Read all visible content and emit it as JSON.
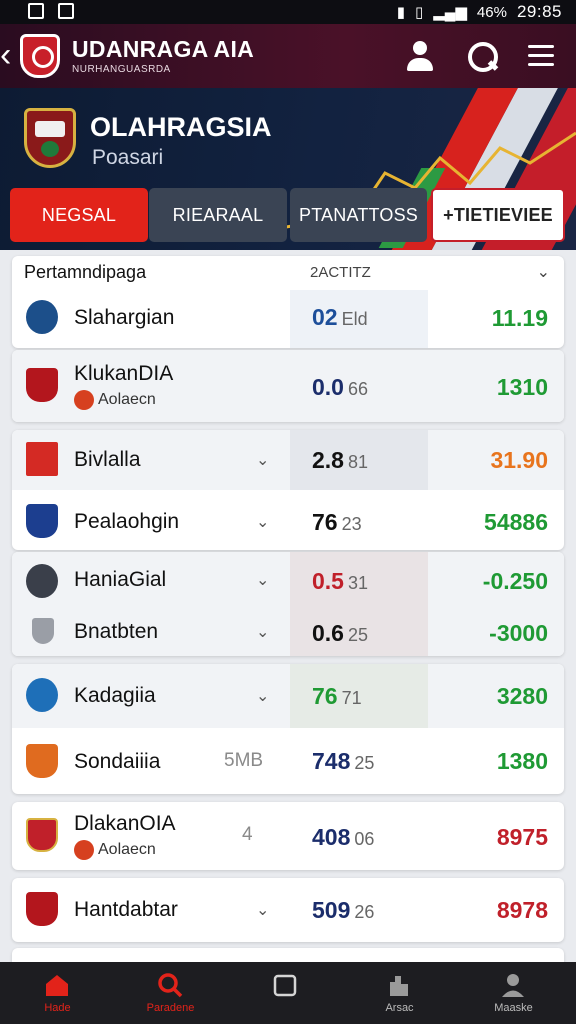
{
  "status": {
    "battery": "46%",
    "time": "29:85"
  },
  "appbar": {
    "title": "UDANRAGA AIA",
    "subtitle": "NURHANGUASRDA"
  },
  "hero": {
    "title": "OLAHRAGSIA",
    "subtitle": "Poasari"
  },
  "tabs": [
    {
      "label": "NEGSAL"
    },
    {
      "label": "RIEARAAL"
    },
    {
      "label": "PTANATTOSS"
    },
    {
      "label": "+TIETIEVIEE"
    }
  ],
  "picker": {
    "label": "Pertamndipaga",
    "selected": "2ACTITZ"
  },
  "matches": [
    {
      "team": "Slahargian",
      "sub": "",
      "extra": "",
      "score": "02",
      "score_small": "Eld",
      "odds": "11.19",
      "odds_color": "#1f9a34",
      "score_color": "#1d4f9a",
      "badge": "#1c4f8a"
    },
    {
      "team": "KlukanDIA",
      "sub": "Aolaecn",
      "extra": "",
      "score": "0.0",
      "score_small": "66",
      "odds": "1310",
      "odds_color": "#1f9a34",
      "score_color": "#1b2d6b",
      "badge": "#b3161d"
    },
    {
      "team": "Bivlalla",
      "sub": "",
      "extra": "",
      "score": "2.8",
      "score_small": "81",
      "odds": "31.90",
      "odds_color": "#e8741d",
      "score_color": "#111",
      "badge": "#d42a24"
    },
    {
      "team": "Pealaohgin",
      "sub": "",
      "extra": "",
      "score": "76",
      "score_small": "23",
      "odds": "54886",
      "odds_color": "#1f9a34",
      "score_color": "#111",
      "badge": "#1c3e8f"
    },
    {
      "team": "HaniaGial",
      "sub": "",
      "extra": "",
      "score": "0.5",
      "score_small": "31",
      "odds": "-0.250",
      "odds_color": "#1f9a34",
      "score_color": "#c0202a",
      "badge": "#3a3f4a"
    },
    {
      "team": "Bnatbten",
      "sub": "",
      "extra": "",
      "score": "0.6",
      "score_small": "25",
      "odds": "-3000",
      "odds_color": "#1f9a34",
      "score_color": "#111",
      "badge": "#9a9ea6"
    },
    {
      "team": "Kadagiia",
      "sub": "",
      "extra": "",
      "score": "76",
      "score_small": "71",
      "odds": "3280",
      "odds_color": "#1f9a34",
      "score_color": "#1f9a34",
      "badge": "#1e6fb8"
    },
    {
      "team": "Sondaiiia",
      "sub": "",
      "extra": "5MB",
      "score": "748",
      "score_small": "25",
      "odds": "1380",
      "odds_color": "#1f9a34",
      "score_color": "#1b2d6b",
      "badge": "#e06b1f"
    },
    {
      "team": "DlakanOIA",
      "sub": "Aolaecn",
      "extra": "4",
      "score": "408",
      "score_small": "06",
      "odds": "8975",
      "odds_color": "#c0202a",
      "score_color": "#1b2d6b",
      "badge": "#c0202a"
    },
    {
      "team": "Hantdabtar",
      "sub": "",
      "extra": "",
      "score": "509",
      "score_small": "26",
      "odds": "8978",
      "odds_color": "#c0202a",
      "score_color": "#1b2d6b",
      "badge": "#b3161d"
    }
  ],
  "nav": [
    {
      "label": "Hade",
      "icon": "home-icon"
    },
    {
      "label": "Paradene",
      "icon": "search-icon"
    },
    {
      "label": "",
      "icon": "calendar-icon"
    },
    {
      "label": "Arsac",
      "icon": "stats-icon"
    },
    {
      "label": "Maaske",
      "icon": "profile-icon"
    }
  ]
}
